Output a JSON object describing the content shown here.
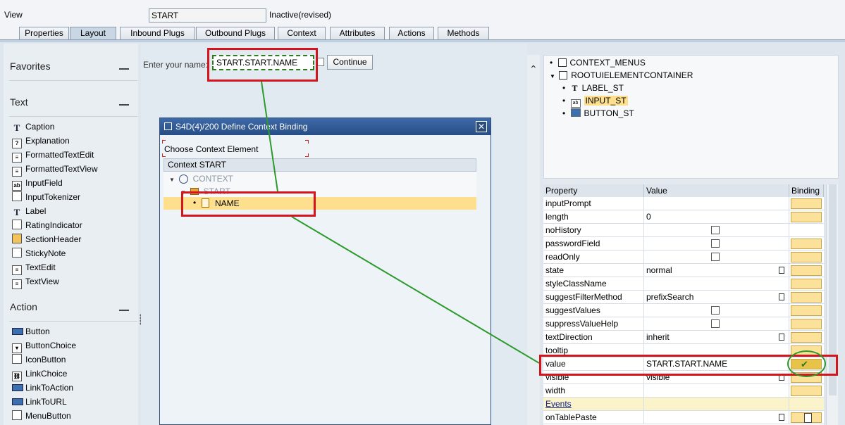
{
  "header": {
    "view_label": "View",
    "view_value": "START",
    "status": "Inactive(revised)"
  },
  "tabs": [
    {
      "label": "Properties"
    },
    {
      "label": "Layout"
    },
    {
      "label": "Inbound Plugs"
    },
    {
      "label": "Outbound Plugs"
    },
    {
      "label": "Context"
    },
    {
      "label": "Attributes"
    },
    {
      "label": "Actions"
    },
    {
      "label": "Methods"
    }
  ],
  "palette": {
    "favorites": "Favorites",
    "text_group": "Text",
    "text_items": [
      {
        "label": "Caption",
        "icon": "text-t-icon"
      },
      {
        "label": "Explanation",
        "icon": "help-icon"
      },
      {
        "label": "FormattedTextEdit",
        "icon": "formatted-text-icon"
      },
      {
        "label": "FormattedTextView",
        "icon": "formatted-text-icon"
      },
      {
        "label": "InputField",
        "icon": "input-field-icon"
      },
      {
        "label": "InputTokenizer",
        "icon": "tokenizer-icon"
      },
      {
        "label": "Label",
        "icon": "text-t-icon"
      },
      {
        "label": "RatingIndicator",
        "icon": "rating-icon"
      },
      {
        "label": "SectionHeader",
        "icon": "section-header-icon"
      },
      {
        "label": "StickyNote",
        "icon": "sticky-note-icon"
      },
      {
        "label": "TextEdit",
        "icon": "text-edit-icon"
      },
      {
        "label": "TextView",
        "icon": "text-view-icon"
      }
    ],
    "action_group": "Action",
    "action_items": [
      {
        "label": "Button",
        "icon": "button-icon"
      },
      {
        "label": "ButtonChoice",
        "icon": "button-choice-icon"
      },
      {
        "label": "IconButton",
        "icon": "icon-button-icon"
      },
      {
        "label": "LinkChoice",
        "icon": "link-choice-icon"
      },
      {
        "label": "LinkToAction",
        "icon": "link-icon"
      },
      {
        "label": "LinkToURL",
        "icon": "link-url-icon"
      },
      {
        "label": "MenuButton",
        "icon": "menu-button-icon"
      }
    ]
  },
  "canvas": {
    "name_label": "Enter your name:",
    "name_value": "START.START.NAME",
    "continue_label": "Continue"
  },
  "dialog": {
    "title": "S4D(4)/200 Define Context Binding",
    "close_glyph": "✕",
    "choose_label": "Choose Context Element",
    "tree_header": "Context START",
    "nodes": [
      "CONTEXT",
      "START",
      "NAME"
    ]
  },
  "ui_tree": {
    "nodes": [
      "CONTEXT_MENUS",
      "ROOTUIELEMENTCONTAINER",
      "LABEL_ST",
      "INPUT_ST",
      "BUTTON_ST"
    ]
  },
  "properties": {
    "headers": [
      "Property",
      "Value",
      "Binding"
    ],
    "rows": [
      {
        "name": "inputPrompt",
        "value": ""
      },
      {
        "name": "length",
        "value": "0"
      },
      {
        "name": "noHistory",
        "value": ""
      },
      {
        "name": "passwordField",
        "value": ""
      },
      {
        "name": "readOnly",
        "value": ""
      },
      {
        "name": "state",
        "value": "normal"
      },
      {
        "name": "styleClassName",
        "value": ""
      },
      {
        "name": "suggestFilterMethod",
        "value": "prefixSearch"
      },
      {
        "name": "suggestValues",
        "value": ""
      },
      {
        "name": "suppressValueHelp",
        "value": ""
      },
      {
        "name": "textDirection",
        "value": "inherit"
      },
      {
        "name": "tooltip",
        "value": ""
      },
      {
        "name": "value",
        "value": "START.START.NAME"
      },
      {
        "name": "visible",
        "value": "visible"
      },
      {
        "name": "width",
        "value": ""
      },
      {
        "name": "Events",
        "value": ""
      },
      {
        "name": "onTablePaste",
        "value": ""
      }
    ]
  },
  "colors": {
    "annotation_red": "#d5141e",
    "annotation_green": "#2c9a2c",
    "selection_yellow": "#fddf8e",
    "dialog_blue": "#274d85"
  }
}
